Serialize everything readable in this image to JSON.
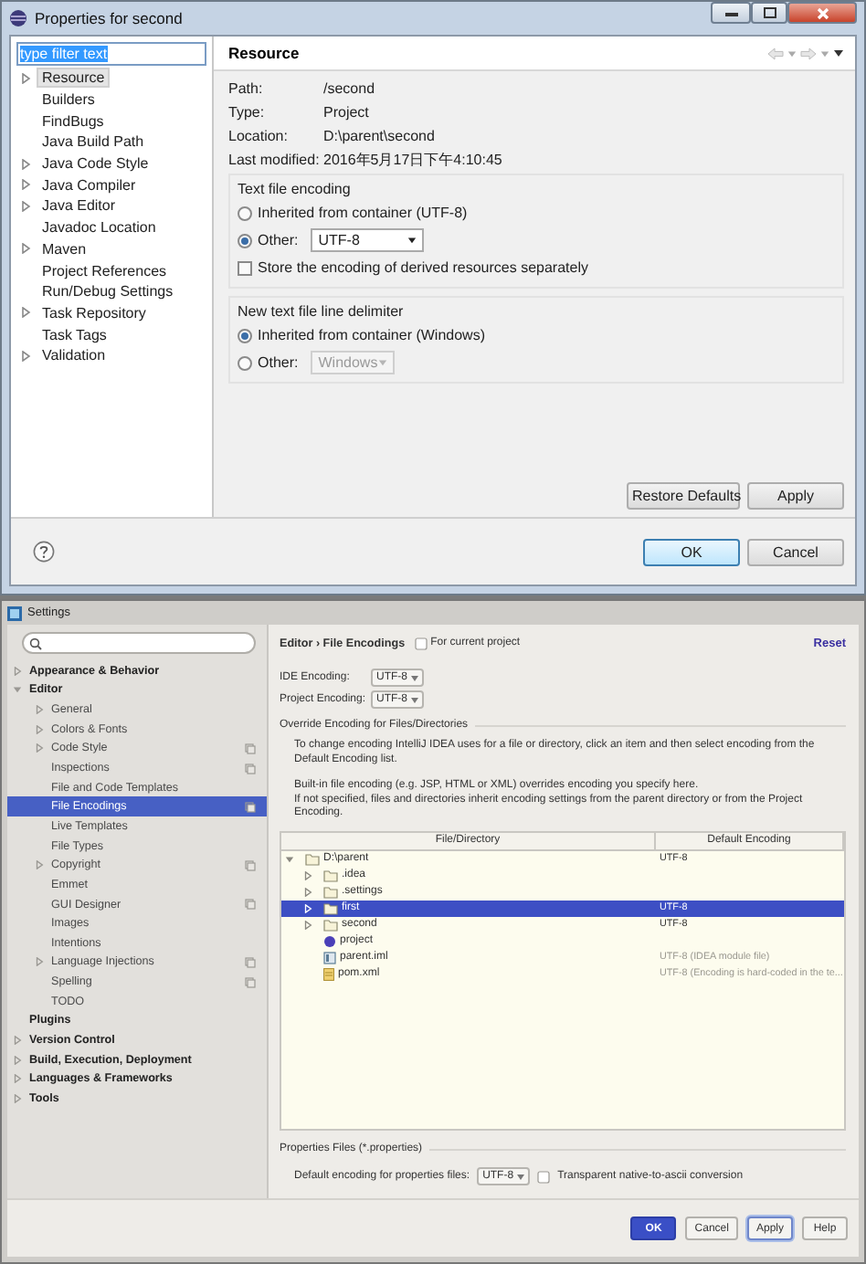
{
  "properties_window": {
    "title": "Properties for second",
    "filter": {
      "value": "type filter text"
    },
    "tree": [
      {
        "label": "Resource",
        "expanded": false,
        "selected": true
      },
      {
        "label": "Builders",
        "selected": false
      },
      {
        "label": "FindBugs",
        "selected": false
      },
      {
        "label": "Java Build Path",
        "selected": false
      },
      {
        "label": "Java Code Style",
        "expanded": false,
        "selected": false
      },
      {
        "label": "Java Compiler",
        "expanded": false,
        "selected": false
      },
      {
        "label": "Java Editor",
        "expanded": false,
        "selected": false
      },
      {
        "label": "Javadoc Location",
        "selected": false
      },
      {
        "label": "Maven",
        "expanded": false,
        "selected": false
      },
      {
        "label": "Project References",
        "selected": false
      },
      {
        "label": "Run/Debug Settings",
        "selected": false
      },
      {
        "label": "Task Repository",
        "expanded": false,
        "selected": false
      },
      {
        "label": "Task Tags",
        "selected": false
      },
      {
        "label": "Validation",
        "expanded": false,
        "selected": false
      }
    ],
    "page": {
      "title": "Resource",
      "info": [
        {
          "label": "Path:",
          "value": "/second"
        },
        {
          "label": "Type:",
          "value": "Project"
        },
        {
          "label": "Location:",
          "value": "D:\\parent\\second"
        },
        {
          "label": "Last modified:",
          "value": "2016年5月17日下午4:10:45"
        }
      ],
      "text_file_encoding": {
        "title": "Text file encoding",
        "options": [
          {
            "label": "Inherited from container (UTF-8)",
            "selected": false
          },
          {
            "label": "Other:",
            "selected": true,
            "value": "UTF-8",
            "disabled": false
          }
        ],
        "derived": {
          "label": "Store the encoding of derived resources separately",
          "checked": false
        }
      },
      "line_delimiter": {
        "title": "New text file line delimiter",
        "options": [
          {
            "label": "Inherited from container (Windows)",
            "selected": true
          },
          {
            "label": "Other:",
            "selected": false,
            "value": "Windows",
            "disabled": true
          }
        ]
      },
      "buttons": [
        "Restore Defaults",
        "Apply"
      ]
    },
    "footer_buttons": [
      {
        "label": "OK",
        "kind": "default"
      },
      {
        "label": "Cancel",
        "kind": "normal"
      }
    ]
  },
  "settings_window": {
    "title": "Settings",
    "sidebar": [
      {
        "label": "Appearance & Behavior",
        "expanded": false,
        "selected": false,
        "project_icon": false
      },
      {
        "label": "Editor",
        "expanded": true,
        "selected": false,
        "project_icon": false,
        "children": [
          {
            "label": "General",
            "expanded": false,
            "selected": false,
            "project_icon": false
          },
          {
            "label": "Colors & Fonts",
            "expanded": false,
            "selected": false,
            "project_icon": false
          },
          {
            "label": "Code Style",
            "expanded": false,
            "selected": false,
            "project_icon": true
          },
          {
            "label": "Inspections",
            "selected": false,
            "project_icon": true
          },
          {
            "label": "File and Code Templates",
            "selected": false,
            "project_icon": false
          },
          {
            "label": "File Encodings",
            "selected": true,
            "project_icon": true
          },
          {
            "label": "Live Templates",
            "selected": false,
            "project_icon": false
          },
          {
            "label": "File Types",
            "selected": false,
            "project_icon": false
          },
          {
            "label": "Copyright",
            "expanded": false,
            "selected": false,
            "project_icon": true
          },
          {
            "label": "Emmet",
            "selected": false,
            "project_icon": false
          },
          {
            "label": "GUI Designer",
            "selected": false,
            "project_icon": true
          },
          {
            "label": "Images",
            "selected": false,
            "project_icon": false
          },
          {
            "label": "Intentions",
            "selected": false,
            "project_icon": false
          },
          {
            "label": "Language Injections",
            "expanded": false,
            "selected": false,
            "project_icon": true
          },
          {
            "label": "Spelling",
            "selected": false,
            "project_icon": true
          },
          {
            "label": "TODO",
            "selected": false,
            "project_icon": false
          }
        ]
      },
      {
        "label": "Plugins",
        "selected": false,
        "project_icon": false
      },
      {
        "label": "Version Control",
        "expanded": false,
        "selected": false,
        "project_icon": false
      },
      {
        "label": "Build, Execution, Deployment",
        "expanded": false,
        "selected": false,
        "project_icon": false
      },
      {
        "label": "Languages & Frameworks",
        "expanded": false,
        "selected": false,
        "project_icon": false
      },
      {
        "label": "Tools",
        "expanded": false,
        "selected": false,
        "project_icon": false
      }
    ],
    "breadcrumb": "Editor › File Encodings",
    "for_current_project": {
      "label": "For current project",
      "checked": false
    },
    "reset": "Reset",
    "ide_encoding": {
      "label": "IDE Encoding:",
      "value": "UTF-8"
    },
    "project_encoding": {
      "label": "Project Encoding:",
      "value": "UTF-8"
    },
    "override_section": "Override Encoding for Files/Directories",
    "hints": [
      "To change encoding IntelliJ IDEA uses for a file or directory, click an item and then select encoding from the Default Encoding list.",
      "Built-in file encoding (e.g. JSP, HTML or XML) overrides encoding you specify here.",
      "If not specified, files and directories inherit encoding settings from the parent directory or from the Project Encoding."
    ],
    "table": {
      "columns": [
        "File/Directory",
        "Default Encoding"
      ],
      "rows": [
        {
          "name": "D:\\parent",
          "kind": "folder",
          "expanded": true,
          "selected": false,
          "encoding": "UTF-8",
          "greyed": false,
          "children": [
            {
              "name": ".idea",
              "kind": "folder",
              "expanded": false,
              "selected": false
            },
            {
              "name": ".settings",
              "kind": "folder",
              "expanded": false,
              "selected": false
            },
            {
              "name": "first",
              "kind": "folder",
              "expanded": false,
              "selected": true,
              "encoding": "UTF-8",
              "greyed": false
            },
            {
              "name": "second",
              "kind": "folder",
              "expanded": false,
              "selected": false,
              "encoding": "UTF-8",
              "greyed": false
            },
            {
              "name": "project",
              "kind": "project",
              "selected": false
            },
            {
              "name": "parent.iml",
              "kind": "module",
              "selected": false,
              "encoding": "UTF-8 (IDEA module file)",
              "greyed": true
            },
            {
              "name": "pom.xml",
              "kind": "maven",
              "selected": false,
              "encoding": "UTF-8 (Encoding is hard-coded in the te...",
              "greyed": true
            }
          ]
        }
      ]
    },
    "properties_section": "Properties Files (*.properties)",
    "properties_encoding": {
      "label": "Default encoding for properties files:",
      "value": "UTF-8"
    },
    "native_to_ascii": {
      "label": "Transparent native-to-ascii conversion",
      "checked": false
    },
    "buttons": [
      {
        "label": "OK",
        "kind": "primary"
      },
      {
        "label": "Cancel",
        "kind": "normal"
      },
      {
        "label": "Apply",
        "kind": "focused"
      },
      {
        "label": "Help",
        "kind": "normal"
      }
    ]
  }
}
